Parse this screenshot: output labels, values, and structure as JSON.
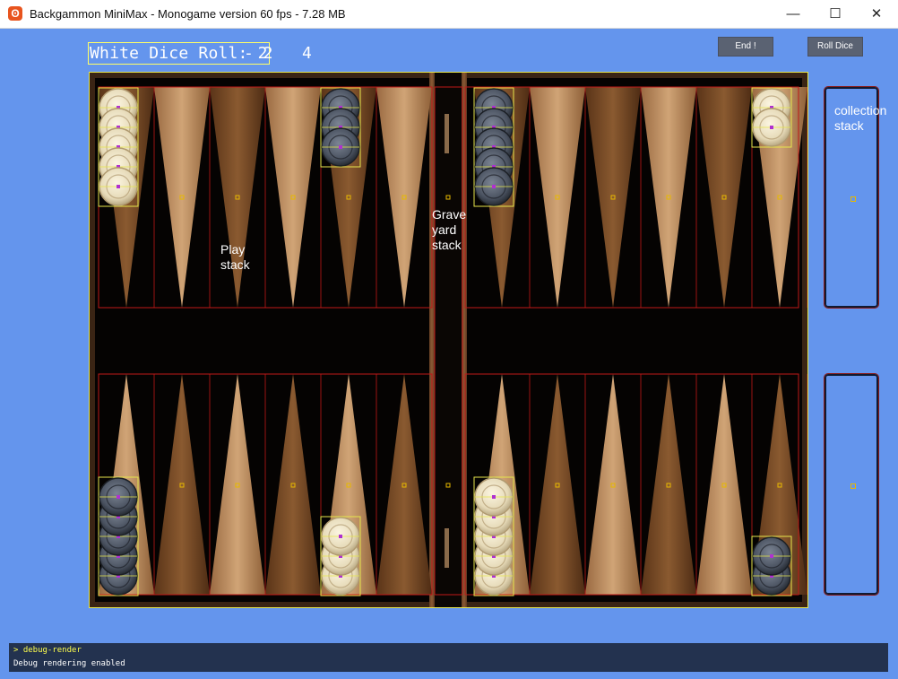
{
  "window": {
    "title": "Backgammon MiniMax - Monogame version 60 fps - 7.28 MB",
    "icon": "monogame-icon",
    "minimize": "—",
    "maximize": "☐",
    "close": "✕"
  },
  "game": {
    "dice_label": "White Dice Roll: 2",
    "dice_rest": "- 2   4",
    "end_button": "End !",
    "roll_button": "Roll Dice",
    "play_stack_label": [
      "Play",
      "stack"
    ],
    "graveyard_label": [
      "Grave",
      "yard",
      "stack"
    ],
    "collection_label": [
      "collection",
      "stack"
    ]
  },
  "colors": {
    "background": "#6495ED",
    "debug_box": "#e6e64c",
    "debug_line": "#c01818",
    "white_checker": "#ece2c4",
    "black_checker": "#4a5260"
  },
  "checkers": {
    "top": [
      {
        "point": 0,
        "color": "white",
        "count": 5
      },
      {
        "point": 4,
        "color": "black",
        "count": 3
      },
      {
        "point": 6,
        "color": "black",
        "count": 5
      },
      {
        "point": 11,
        "color": "white",
        "count": 2
      }
    ],
    "bottom": [
      {
        "point": 0,
        "color": "black",
        "count": 5
      },
      {
        "point": 4,
        "color": "white",
        "count": 3
      },
      {
        "point": 6,
        "color": "white",
        "count": 5
      },
      {
        "point": 11,
        "color": "black",
        "count": 2
      }
    ]
  },
  "console": {
    "command": "> debug-render",
    "output": "Debug rendering enabled"
  }
}
